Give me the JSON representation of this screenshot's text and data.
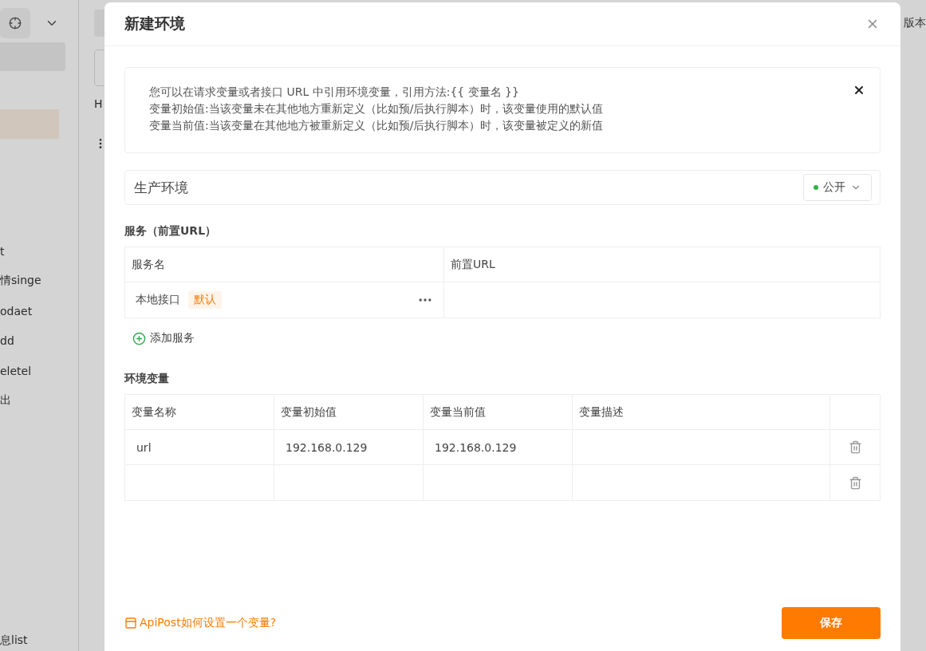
{
  "background": {
    "sidebar_items": [
      {
        "label": "t",
        "selected": false
      },
      {
        "label": "情singe",
        "selected": false
      },
      {
        "label": "odaet",
        "selected": false
      },
      {
        "label": "dd",
        "selected": false
      },
      {
        "label": "eletel",
        "selected": false
      },
      {
        "label": "出",
        "selected": false
      }
    ],
    "sidebar_footer": "息list",
    "main_tab": "H",
    "right_header": "版本"
  },
  "dialog": {
    "title": "新建环境",
    "notice": [
      "您可以在请求变量或者接口 URL 中引用环境变量，引用方法:{{ 变量名 }}",
      "变量初始值:当该变量未在其他地方重新定义（比如预/后执行脚本）时，该变量使用的默认值",
      "变量当前值:当该变量在其他地方被重新定义（比如预/后执行脚本）时，该变量被定义的新值"
    ],
    "env_name": "生产环境",
    "visibility": {
      "label": "公开",
      "color": "#2fb344"
    },
    "services": {
      "title": "服务（前置URL）",
      "columns": [
        "服务名",
        "前置URL"
      ],
      "rows": [
        {
          "name": "本地接口",
          "tag": "默认"
        }
      ],
      "add_button": "添加服务"
    },
    "variables": {
      "title": "环境变量",
      "columns": [
        "变量名称",
        "变量初始值",
        "变量当前值",
        "变量描述"
      ],
      "rows": [
        {
          "name": "url",
          "initial": "192.168.0.129",
          "current": "192.168.0.129"
        },
        {}
      ]
    },
    "help_link": "ApiPost如何设置一个变量?",
    "save_button": "保存"
  }
}
